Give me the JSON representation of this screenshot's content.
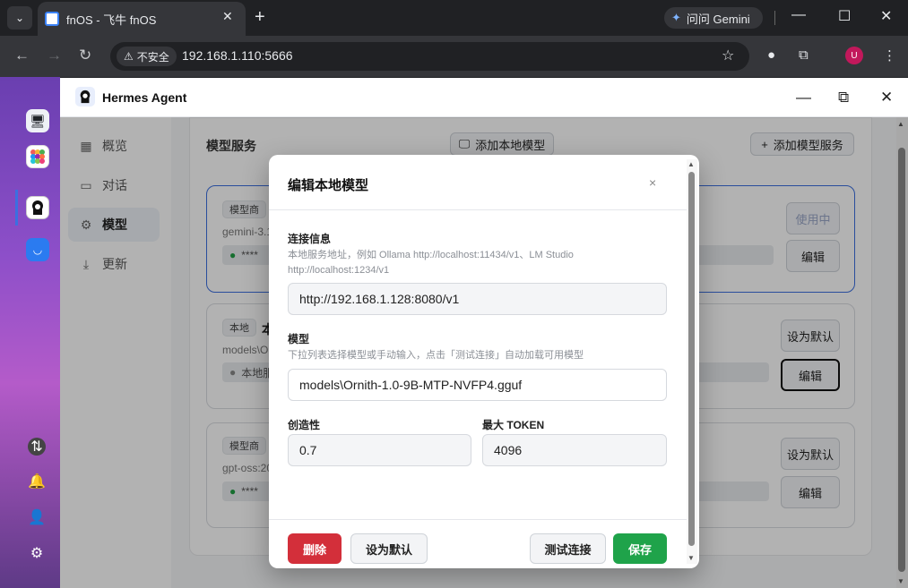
{
  "browser": {
    "tab_title": "fnOS - 飞牛 fnOS",
    "gemini_label": "问问 Gemini",
    "security_label": "不安全",
    "url": "192.168.1.110:5666",
    "profile_initial": "U"
  },
  "app": {
    "title": "Hermes Agent"
  },
  "sidebar": {
    "items": [
      {
        "label": "概览",
        "icon": "grid-icon"
      },
      {
        "label": "对话",
        "icon": "chat-icon"
      },
      {
        "label": "模型",
        "icon": "gear-icon"
      },
      {
        "label": "更新",
        "icon": "download-icon"
      }
    ]
  },
  "panel": {
    "title": "模型服务",
    "add_local_label": "添加本地模型",
    "add_service_label": "添加模型服务"
  },
  "providers": [
    {
      "tag": "模型商",
      "model": "gemini-3.1",
      "key": "****",
      "btn1": "使用中",
      "btn2": "编辑"
    },
    {
      "tag": "本地",
      "name": "本",
      "model": "models\\O",
      "key": "本地服",
      "btn1": "设为默认",
      "btn2": "编辑"
    },
    {
      "tag": "模型商",
      "model": "gpt-oss:20",
      "key": "****",
      "btn1": "设为默认",
      "btn2": "编辑"
    }
  ],
  "modal": {
    "title": "编辑本地模型",
    "close": "×",
    "conn_label": "连接信息",
    "conn_hint_1": "本地服务地址，例如 Ollama http://localhost:11434/v1、LM Studio",
    "conn_hint_2": "http://localhost:1234/v1",
    "conn_value": "http://192.168.1.128:8080/v1",
    "model_label": "模型",
    "model_hint": "下拉列表选择模型或手动输入，点击「测试连接」自动加载可用模型",
    "model_value": "models\\Ornith-1.0-9B-MTP-NVFP4.gguf",
    "creativity_label": "创造性",
    "creativity_value": "0.7",
    "maxtoken_label": "最大 TOKEN",
    "maxtoken_value": "4096",
    "delete_label": "删除",
    "default_label": "设为默认",
    "test_label": "测试连接",
    "save_label": "保存"
  },
  "colors": {
    "danger": "#d32f3a",
    "success": "#1fa34a",
    "accent": "#3b6fe0"
  }
}
